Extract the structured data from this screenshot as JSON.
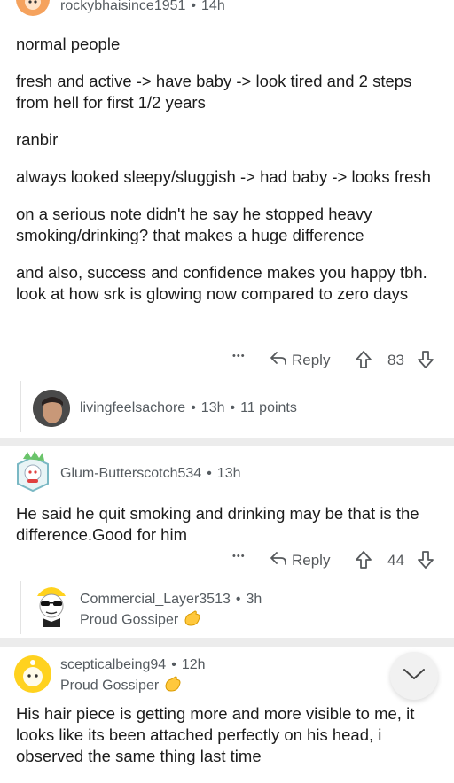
{
  "comments": [
    {
      "username": "rockybhaisince1951",
      "time": "14h",
      "paragraphs": [
        "normal people",
        "fresh and active -> have baby -> look tired and 2 steps from hell for first 1/2 years",
        "ranbir",
        "always looked sleepy/sluggish -> had baby -> looks fresh",
        "on a serious note didn't he say he stopped heavy smoking/drinking? that makes a huge difference",
        "and also, success and confidence makes you happy tbh. look at how srk is glowing now compared to zero days"
      ],
      "more": "•••",
      "reply_label": "Reply",
      "score": "83",
      "child": {
        "username": "livingfeelsachore",
        "time": "13h",
        "points": "11 points"
      }
    },
    {
      "username": "Glum-Butterscotch534",
      "time": "13h",
      "text": "He said he quit smoking and drinking may be that is the difference.Good for him",
      "more": "•••",
      "reply_label": "Reply",
      "score": "44",
      "child": {
        "username": "Commercial_Layer3513",
        "time": "3h",
        "flair": "Proud Gossiper"
      }
    },
    {
      "username": "scepticalbeing94",
      "time": "12h",
      "flair": "Proud Gossiper",
      "text": "His hair piece is getting more and more visible to me, it looks like its been attached perfectly on his head, i observed the same thing last time"
    }
  ],
  "dot": "•",
  "icons": [
    "reply-arrow-icon",
    "upvote-icon",
    "downvote-icon",
    "chevron-down-icon",
    "clapping-hand-icon"
  ],
  "colors": {
    "separator": "#ececec",
    "meta": "#555b60",
    "text": "#1c1c1c",
    "avatar_orange": "#f5a25d",
    "avatar_yellow": "#ffd21f"
  }
}
